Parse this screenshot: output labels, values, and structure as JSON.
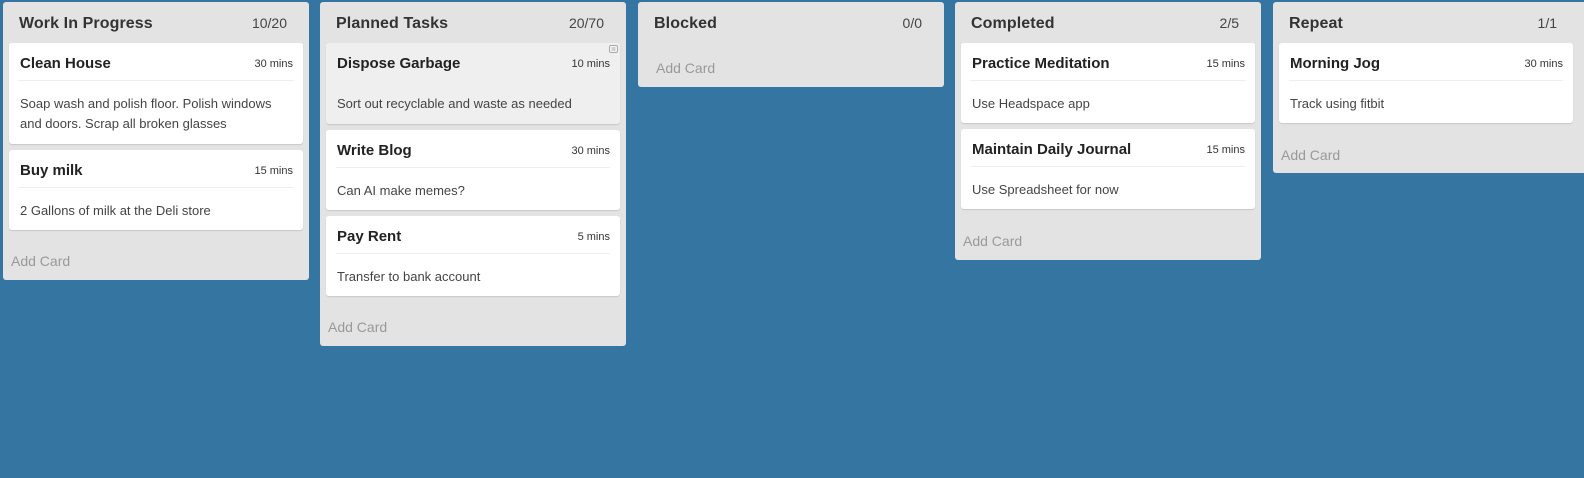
{
  "lanes": [
    {
      "title": "Work In Progress",
      "count": "10/20",
      "add_label": "Add Card",
      "cards": [
        {
          "title": "Clean House",
          "time": "30 mins",
          "description": "Soap wash and polish floor. Polish windows and doors. Scrap all broken glasses"
        },
        {
          "title": "Buy milk",
          "time": "15 mins",
          "description": "2 Gallons of milk at the Deli store"
        }
      ]
    },
    {
      "title": "Planned Tasks",
      "count": "20/70",
      "add_label": "Add Card",
      "cards": [
        {
          "title": "Dispose Garbage",
          "time": "10 mins",
          "description": "Sort out recyclable and waste as needed"
        },
        {
          "title": "Write Blog",
          "time": "30 mins",
          "description": "Can AI make memes?"
        },
        {
          "title": "Pay Rent",
          "time": "5 mins",
          "description": "Transfer to bank account"
        }
      ]
    },
    {
      "title": "Blocked",
      "count": "0/0",
      "add_label": "Add Card",
      "cards": []
    },
    {
      "title": "Completed",
      "count": "2/5",
      "add_label": "Add Card",
      "cards": [
        {
          "title": "Practice Meditation",
          "time": "15 mins",
          "description": "Use Headspace app"
        },
        {
          "title": "Maintain Daily Journal",
          "time": "15 mins",
          "description": "Use Spreadsheet for now"
        }
      ]
    },
    {
      "title": "Repeat",
      "count": "1/1",
      "add_label": "Add Card",
      "cards": [
        {
          "title": "Morning Jog",
          "time": "30 mins",
          "description": "Track using fitbit"
        }
      ]
    }
  ],
  "colors": {
    "board_background": "#3476a1",
    "lane_background": "#e3e3e3",
    "card_background": "#ffffff",
    "add_card_text": "#999999"
  },
  "icons": {
    "drag_handle": "drag-handle-icon"
  }
}
